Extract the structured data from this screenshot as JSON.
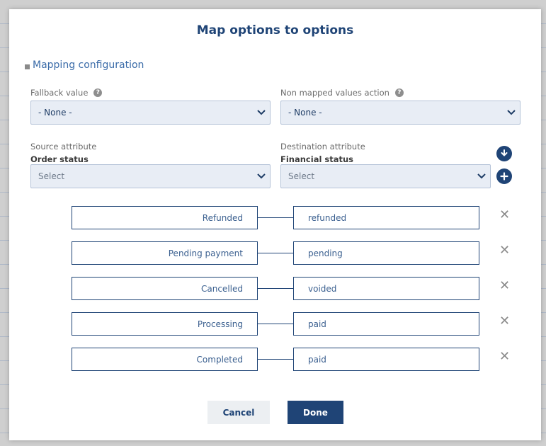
{
  "dialog": {
    "title": "Map options to options"
  },
  "section": {
    "label": "Mapping configuration"
  },
  "fallback": {
    "label": "Fallback value",
    "value": "- None -"
  },
  "non_mapped": {
    "label": "Non mapped values action",
    "value": "- None -"
  },
  "source": {
    "label": "Source attribute",
    "attribute": "Order status",
    "placeholder": "Select"
  },
  "destination": {
    "label": "Destination attribute",
    "attribute": "Financial status",
    "placeholder": "Select"
  },
  "mappings": [
    {
      "source": "Refunded",
      "destination": "refunded"
    },
    {
      "source": "Pending payment",
      "destination": "pending"
    },
    {
      "source": "Cancelled",
      "destination": "voided"
    },
    {
      "source": "Processing",
      "destination": "paid"
    },
    {
      "source": "Completed",
      "destination": "paid"
    }
  ],
  "remove_glyph": "✕",
  "help_glyph": "?",
  "buttons": {
    "cancel": "Cancel",
    "done": "Done"
  },
  "icons": {
    "help": "help-icon",
    "chevron": "chevron-down-icon",
    "download": "download-icon",
    "add": "plus-icon",
    "remove": "close-icon"
  },
  "colors": {
    "primary": "#1f4476",
    "select_bg": "#e8edf5",
    "link": "#3a6ba8"
  }
}
